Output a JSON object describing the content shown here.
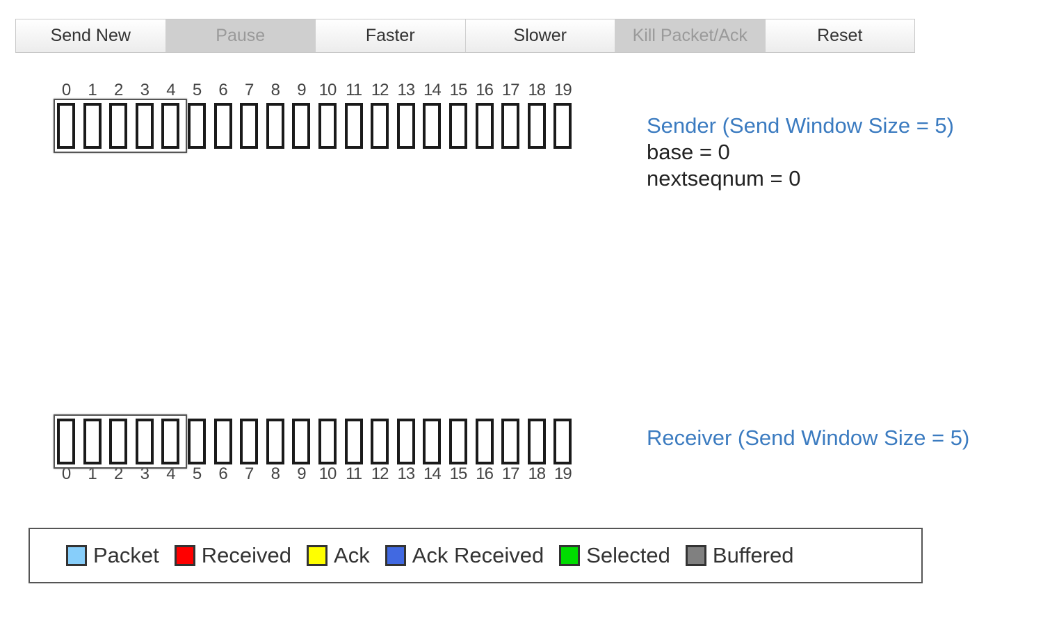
{
  "toolbar": {
    "buttons": [
      {
        "name": "send-new-button",
        "label": "Send New",
        "disabled": false
      },
      {
        "name": "pause-button",
        "label": "Pause",
        "disabled": true
      },
      {
        "name": "faster-button",
        "label": "Faster",
        "disabled": false
      },
      {
        "name": "slower-button",
        "label": "Slower",
        "disabled": false
      },
      {
        "name": "kill-packet-ack-button",
        "label": "Kill Packet/Ack",
        "disabled": true
      },
      {
        "name": "reset-button",
        "label": "Reset",
        "disabled": false
      }
    ]
  },
  "sequence_numbers": [
    "0",
    "1",
    "2",
    "3",
    "4",
    "5",
    "6",
    "7",
    "8",
    "9",
    "10",
    "11",
    "12",
    "13",
    "14",
    "15",
    "16",
    "17",
    "18",
    "19"
  ],
  "window_size": 5,
  "sender": {
    "title": "Sender (Send Window Size = 5)",
    "base_label": "base = 0",
    "nextseqnum_label": "nextseqnum = 0"
  },
  "receiver": {
    "title": "Receiver (Send Window Size = 5)"
  },
  "legend": [
    {
      "name": "packet",
      "label": "Packet",
      "color": "#87cefa"
    },
    {
      "name": "received",
      "label": "Received",
      "color": "#ff0000"
    },
    {
      "name": "ack",
      "label": "Ack",
      "color": "#ffff00"
    },
    {
      "name": "ack-received",
      "label": "Ack Received",
      "color": "#4169e1"
    },
    {
      "name": "selected",
      "label": "Selected",
      "color": "#00dd00"
    },
    {
      "name": "buffered",
      "label": "Buffered",
      "color": "#808080"
    }
  ]
}
